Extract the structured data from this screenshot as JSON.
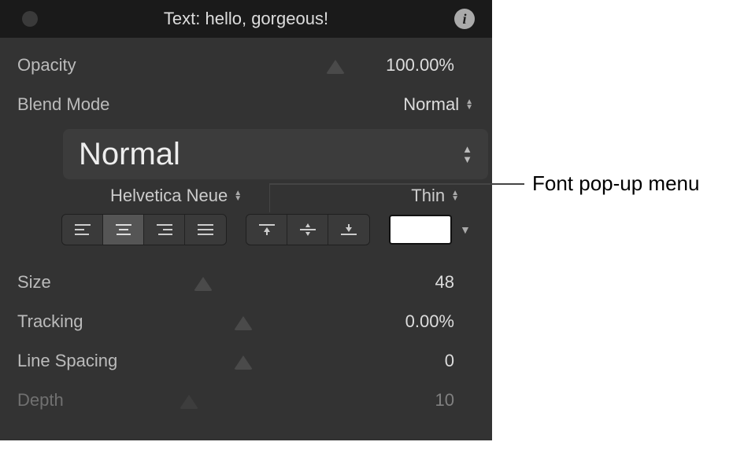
{
  "title": "Text: hello, gorgeous!",
  "opacity": {
    "label": "Opacity",
    "value": "100.00%",
    "thumb_pct": 88
  },
  "blend": {
    "label": "Blend Mode",
    "value": "Normal"
  },
  "preset": {
    "value": "Normal"
  },
  "font": {
    "family": "Helvetica Neue",
    "weight": "Thin"
  },
  "size": {
    "label": "Size",
    "value": "48",
    "thumb_pct": 22
  },
  "tracking": {
    "label": "Tracking",
    "value": "0.00%",
    "thumb_pct": 42
  },
  "linespacing": {
    "label": "Line Spacing",
    "value": "0",
    "thumb_pct": 42
  },
  "depth": {
    "label": "Depth",
    "value": "10",
    "thumb_pct": 15
  },
  "callout": "Font pop-up menu"
}
